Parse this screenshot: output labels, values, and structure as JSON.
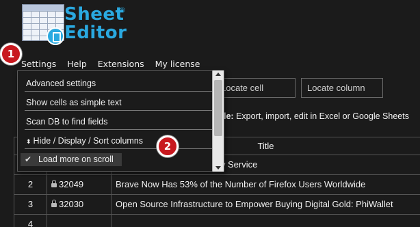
{
  "logo": {
    "line1": "Sheet",
    "line2": "Editor",
    "reg": "®"
  },
  "badges": {
    "first": "1",
    "second": "2"
  },
  "menubar": [
    "Settings",
    "Help",
    "Extensions",
    "My license"
  ],
  "dropdown": {
    "items": [
      "Advanced settings",
      "Show cells as simple text",
      "Scan DB to find fields",
      "Hide / Display / Sort columns"
    ],
    "checkbox_item": "Load more on scroll"
  },
  "toolbar": {
    "locate_cell": "Locate cell",
    "locate_column": "Locate column"
  },
  "info": {
    "bold": "le:",
    "text": " Export, import, edit in Excel or Google Sheets"
  },
  "table": {
    "header_title": "Title",
    "rows": [
      {
        "num": "",
        "id": "",
        "title": "prise Support With this New Service"
      },
      {
        "num": "2",
        "id": "32049",
        "title": "Brave Now Has 53% of the Number of Firefox Users Worldwide"
      },
      {
        "num": "3",
        "id": "32030",
        "title": "Open Source Infrastructure to Empower Buying Digital Gold: PhiWallet"
      },
      {
        "num": "4",
        "id": "",
        "title": ""
      }
    ]
  },
  "colors": {
    "accent": "#2aa9e0",
    "badge": "#c8191f",
    "background": "#1b1b1b"
  }
}
